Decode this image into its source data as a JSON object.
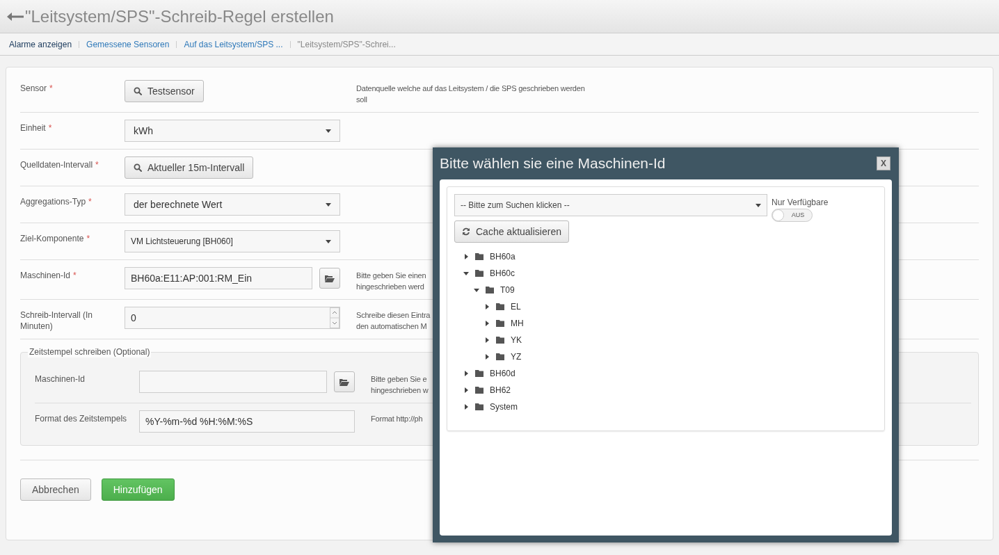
{
  "header": {
    "title": "\"Leitsystem/SPS\"-Schreib-Regel erstellen"
  },
  "breadcrumbs": [
    {
      "label": "Alarme anzeigen",
      "kind": "home"
    },
    {
      "label": "Gemessene Sensoren",
      "kind": "link"
    },
    {
      "label": "Auf das Leitsystem/SPS ...",
      "kind": "link"
    },
    {
      "label": "\"Leitsystem/SPS\"-Schrei...",
      "kind": "current"
    }
  ],
  "form": {
    "rows": [
      {
        "label": "Sensor",
        "required_mark": "*",
        "kind": "search",
        "value": "Testsensor",
        "description": [
          "Datenquelle welche auf das Leitsystem / die SPS geschrieben werden",
          "soll"
        ]
      },
      {
        "label": "Einheit",
        "required_mark": "*",
        "kind": "select",
        "value": "kWh"
      },
      {
        "label": "Quelldaten-Intervall",
        "required_mark": "*",
        "kind": "search",
        "value": "Aktueller 15m-Intervall"
      },
      {
        "label": "Aggregations-Typ",
        "required_mark": "*",
        "kind": "select",
        "value": "der berechnete Wert"
      },
      {
        "label": "Ziel-Komponente",
        "required_mark": "*",
        "kind": "combo",
        "value": "VM Lichtsteuerung [BH060]"
      },
      {
        "label": "Maschinen-Id",
        "required_mark": "*",
        "kind": "picker",
        "value": "BH60a:E11:AP:001:RM_Ein",
        "description": [
          "Bitte geben Sie einen",
          "hingeschrieben werd"
        ]
      },
      {
        "label": "Schreib-Intervall (In Minuten)",
        "kind": "number",
        "value": "0",
        "description": [
          "Schreibe diesen Eintra",
          "den automatischen M"
        ]
      }
    ],
    "fieldset": {
      "legend": "Zeitstempel schreiben (Optional)",
      "rows": [
        {
          "label": "Maschinen-Id",
          "kind": "picker",
          "value": "",
          "description": [
            "Bitte geben Sie e",
            "hingeschrieben w"
          ]
        },
        {
          "label": "Format des Zeitstempels",
          "kind": "input",
          "value": "%Y-%m-%d %H:%M:%S",
          "description": [
            "Format http://ph"
          ]
        }
      ]
    },
    "buttons": [
      {
        "label": "Abbrechen",
        "kind": "default"
      },
      {
        "label": "Hinzufügen",
        "kind": "primary"
      }
    ]
  },
  "modal": {
    "title": "Bitte wählen sie eine Maschinen-Id",
    "close": "X",
    "search": {
      "placeholder": "-- Bitte zum Suchen klicken --"
    },
    "toggle": {
      "label": "Nur Verfügbare",
      "on": false,
      "text": "AUS"
    },
    "refresh_button": "Cache aktualisieren",
    "tree": [
      {
        "label": "BH60a",
        "expanded": false
      },
      {
        "label": "BH60c",
        "expanded": true,
        "children": [
          {
            "label": "T09",
            "expanded": true,
            "children": [
              {
                "label": "EL",
                "expanded": false
              },
              {
                "label": "MH",
                "expanded": false
              },
              {
                "label": "YK",
                "expanded": false
              },
              {
                "label": "YZ",
                "expanded": false
              }
            ]
          }
        ]
      },
      {
        "label": "BH60d",
        "expanded": false
      },
      {
        "label": "BH62",
        "expanded": false
      },
      {
        "label": "System",
        "expanded": false
      }
    ]
  }
}
